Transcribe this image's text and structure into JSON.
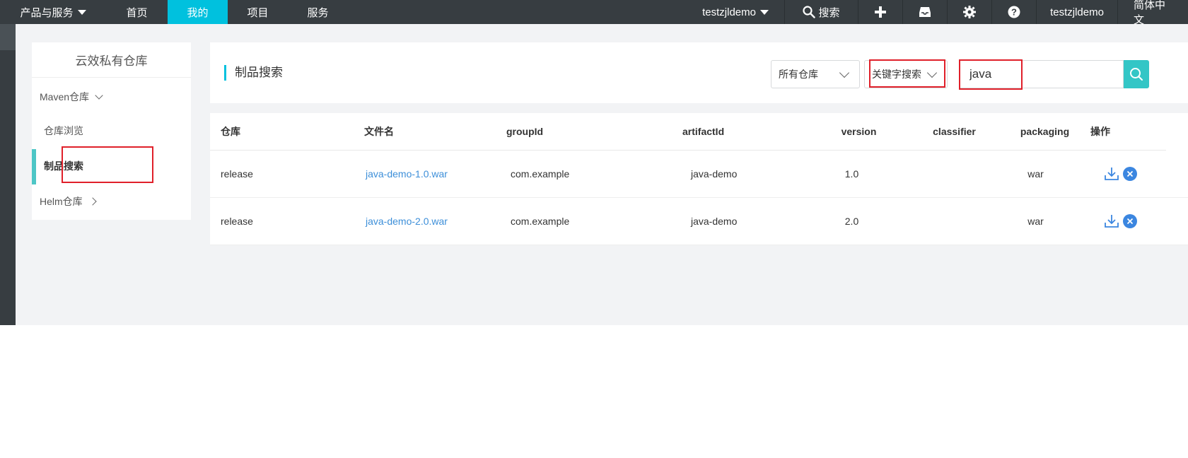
{
  "topnav": {
    "products": "产品与服务",
    "home": "首页",
    "mine": "我的",
    "project": "项目",
    "service": "服务",
    "account": "testzjldemo",
    "search": "搜索",
    "user": "testzjldemo",
    "lang": "简体中文",
    "active_color": "#00c1de"
  },
  "sidebar": {
    "title": "云效私有仓库",
    "items": [
      {
        "label": "Maven仓库"
      },
      {
        "label": "仓库浏览"
      },
      {
        "label": "制品搜索"
      },
      {
        "label": "Helm仓库"
      }
    ],
    "active_color": "#4dc6c6"
  },
  "search_panel": {
    "title": "制品搜索",
    "repo_select": "所有仓库",
    "mode_select": "关键字搜索",
    "query": "java"
  },
  "table": {
    "headers": [
      "仓库",
      "文件名",
      "groupId",
      "artifactId",
      "version",
      "classifier",
      "packaging",
      "操作"
    ],
    "rows": [
      {
        "repo": "release",
        "file": "java-demo-1.0.war",
        "group": "com.example",
        "artifact": "java-demo",
        "version": "1.0",
        "classifier": "",
        "packaging": "war"
      },
      {
        "repo": "release",
        "file": "java-demo-2.0.war",
        "group": "com.example",
        "artifact": "java-demo",
        "version": "2.0",
        "classifier": "",
        "packaging": "war"
      }
    ]
  },
  "icons": {
    "search": "search-icon",
    "plus": "plus-icon",
    "inbox": "inbox-icon",
    "settings": "gear-icon",
    "help": "help-icon",
    "download": "download-icon",
    "delete": "close-icon"
  }
}
